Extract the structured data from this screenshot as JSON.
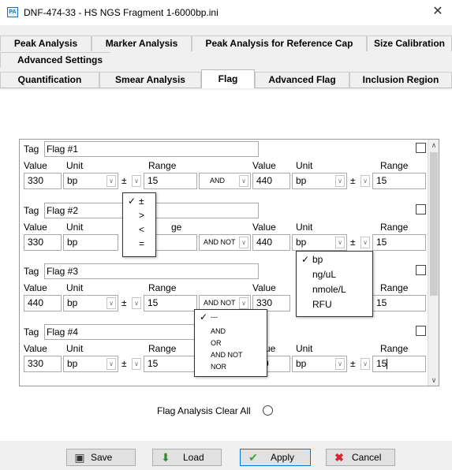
{
  "window": {
    "title": "DNF-474-33 - HS NGS Fragment 1-6000bp.ini",
    "icon_text": "PA"
  },
  "tabs": {
    "row1": [
      "Peak Analysis",
      "Marker Analysis",
      "Peak Analysis for Reference Cap",
      "Size Calibration"
    ],
    "row2": [
      "Advanced Settings"
    ],
    "row3": [
      "Quantification",
      "Smear Analysis",
      "Flag",
      "Advanced Flag",
      "Inclusion Region"
    ],
    "active": "Flag"
  },
  "labels": {
    "tag": "Tag",
    "value": "Value",
    "unit": "Unit",
    "range": "Range",
    "pm": "±"
  },
  "flags": [
    {
      "tag": "Flag #1",
      "value1": "330",
      "unit1": "bp",
      "range1": "15",
      "op": "AND",
      "value2": "440",
      "unit2": "bp",
      "range2": "15"
    },
    {
      "tag": "Flag #2",
      "value1": "330",
      "unit1": "bp",
      "range1": "",
      "op": "AND NOT",
      "value2": "440",
      "unit2": "bp",
      "range2": "15",
      "range_label_partial": "ge"
    },
    {
      "tag": "Flag #3",
      "value1": "440",
      "unit1": "bp",
      "range1": "15",
      "op": "AND NOT",
      "value2": "330",
      "unit2": "",
      "range2": "15"
    },
    {
      "tag": "Flag #4",
      "value1": "330",
      "unit1": "bp",
      "range1": "15",
      "op": "",
      "value2": "0",
      "unit2": "bp",
      "range2": "15",
      "value_label_partial": "ue"
    }
  ],
  "popups": {
    "sign_options": [
      "±",
      ">",
      "<",
      "="
    ],
    "sign_selected": "±",
    "unit_options": [
      "bp",
      "ng/uL",
      "nmole/L",
      "RFU"
    ],
    "unit_selected": "bp",
    "op_options": [
      "---",
      "AND",
      "OR",
      "AND NOT",
      "NOR"
    ],
    "op_selected": "---"
  },
  "clear_all_label": "Flag Analysis Clear All",
  "buttons": {
    "save": "Save",
    "load": "Load",
    "apply": "Apply",
    "cancel": "Cancel"
  },
  "icons": {
    "save": "floppy-icon",
    "load": "download-arrow-icon",
    "apply": "check-icon",
    "cancel": "x-icon"
  },
  "colors": {
    "apply_border": "#0078d7",
    "cancel_icon": "#d9232e",
    "apply_icon": "#3aa53a",
    "load_icon": "#2e8b2e"
  }
}
